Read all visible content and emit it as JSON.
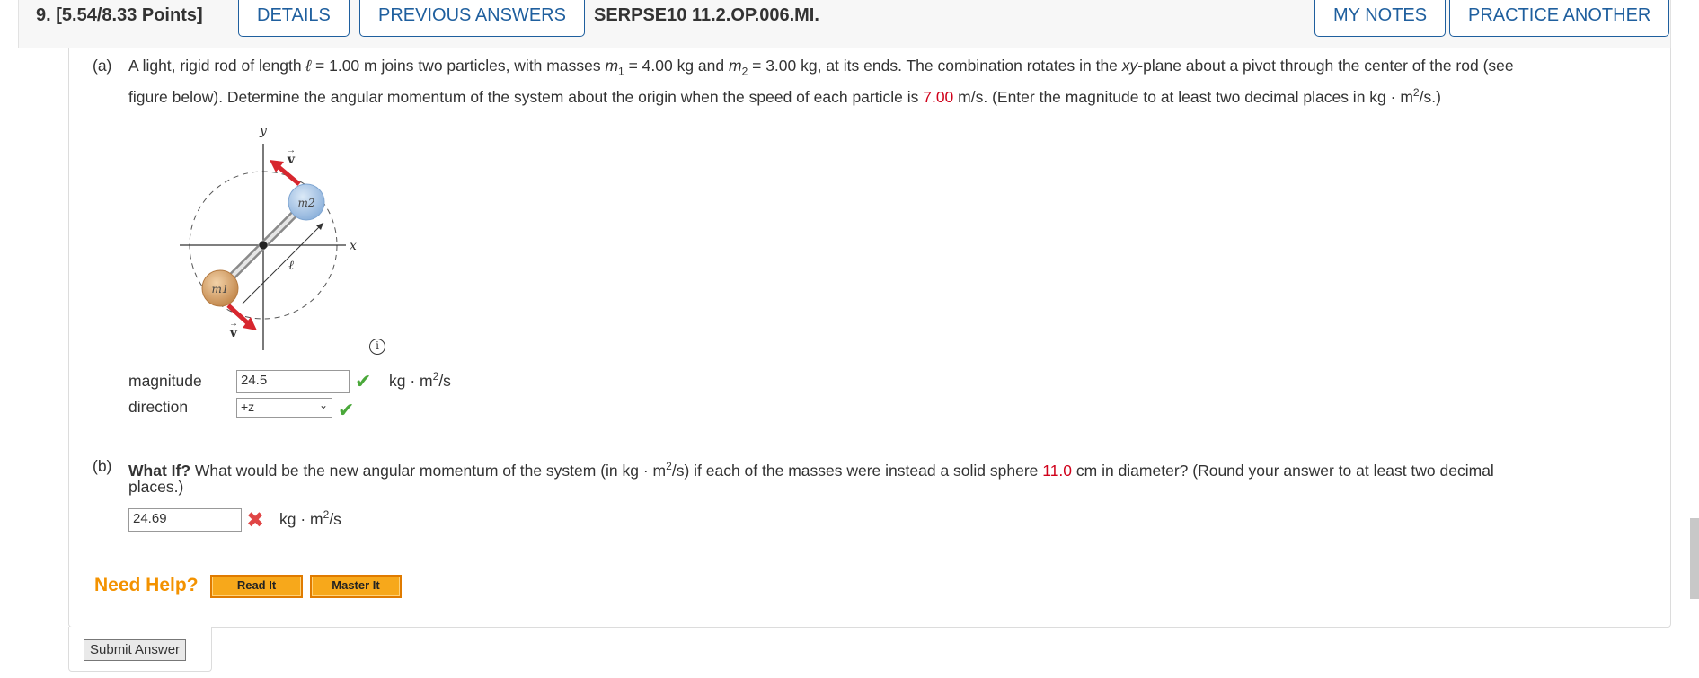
{
  "header": {
    "question_number": "9.",
    "points": "[5.54/8.33 Points]",
    "details_label": "DETAILS",
    "previous_answers_label": "PREVIOUS ANSWERS",
    "question_code": "SERPSE10 11.2.OP.006.MI.",
    "my_notes_label": "MY NOTES",
    "practice_another_label": "PRACTICE ANOTHER"
  },
  "part_a": {
    "marker": "(a)",
    "t1": "A light, rigid rod of length ",
    "ell": "ℓ",
    "t2": " = 1.00 m joins two particles, with masses ",
    "m": "m",
    "sub1": "1",
    "t3": " = 4.00 kg and ",
    "sub2": "2",
    "t4": " = 3.00 kg, at its ends. The combination rotates in the ",
    "xy": "xy",
    "t5": "-plane about a pivot through the center of the rod (see",
    "t6": "figure below). Determine the angular momentum of the system about the origin when the speed of each particle is ",
    "speed": "7.00",
    "t7": " m/s. (Enter the magnitude to at least two decimal places in kg · m",
    "sup2": "2",
    "t8": "/s.)",
    "magnitude_label": "magnitude",
    "magnitude_value": "24.5",
    "direction_label": "direction",
    "direction_value": "+z",
    "unit": "kg · m",
    "unit_tail": "/s"
  },
  "figure": {
    "y_label": "y",
    "x_label": "x",
    "v_label": "v",
    "m1_label": "m1",
    "m2_label": "m2",
    "ell_label": "ℓ",
    "info_icon": "info-icon",
    "arrow_color": "#d7262e",
    "m1_color": "#d9a56f",
    "m2_color": "#aac8e8"
  },
  "part_b": {
    "marker": "(b)",
    "what_if": "What If?",
    "t1": " What would be the new angular momentum of the system (in kg · m",
    "t2": "/s) if each of the masses were instead a solid sphere ",
    "diameter": "11.0",
    "t3": " cm in diameter? (Round your answer to at least two decimal",
    "t4": "places.)",
    "answer_value": "24.69"
  },
  "help": {
    "title": "Need Help?",
    "read_it": "Read It",
    "master_it": "Master It"
  },
  "submit_label": "Submit Answer",
  "colors": {
    "accent": "#1f5f9e",
    "correct": "#4aa83a",
    "incorrect": "#e04545",
    "help": "#f39200",
    "highlight": "#d0021b"
  }
}
